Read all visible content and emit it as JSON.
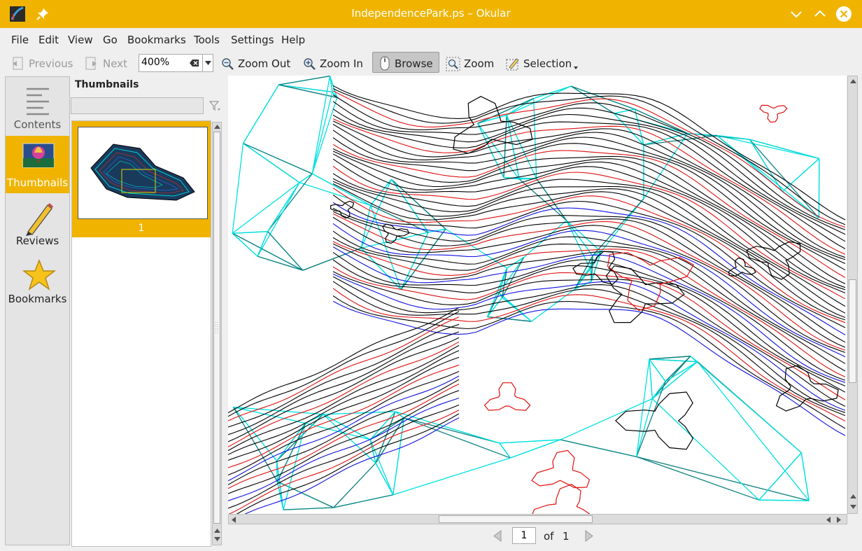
{
  "window": {
    "title": "IndependencePark.ps – Okular"
  },
  "menu": [
    "File",
    "Edit",
    "View",
    "Go",
    "Bookmarks",
    "Tools",
    "Settings",
    "Help"
  ],
  "toolbar": {
    "previous": "Previous",
    "next": "Next",
    "zoom_value": "400%",
    "zoom_out": "Zoom Out",
    "zoom_in": "Zoom In",
    "browse": "Browse",
    "zoom": "Zoom",
    "selection": "Selection"
  },
  "sidebar": {
    "items": [
      {
        "label": "Contents",
        "icon": "contents-icon",
        "active": false
      },
      {
        "label": "Thumbnails",
        "icon": "thumbnails-icon",
        "active": true
      },
      {
        "label": "Reviews",
        "icon": "pencil-icon",
        "active": false
      },
      {
        "label": "Bookmarks",
        "icon": "star-icon",
        "active": false
      }
    ]
  },
  "thumbnails": {
    "title": "Thumbnails",
    "filter_value": "",
    "pages": [
      {
        "number": "1"
      }
    ]
  },
  "navigation": {
    "current_page": "1",
    "of_label": "of",
    "total_pages": "1"
  },
  "colors": {
    "accent": "#f0b400",
    "contour_black": "#000000",
    "contour_red": "#e01010",
    "contour_blue": "#1010e0",
    "mesh_cyan": "#00e0e0",
    "mesh_teal": "#108080"
  }
}
